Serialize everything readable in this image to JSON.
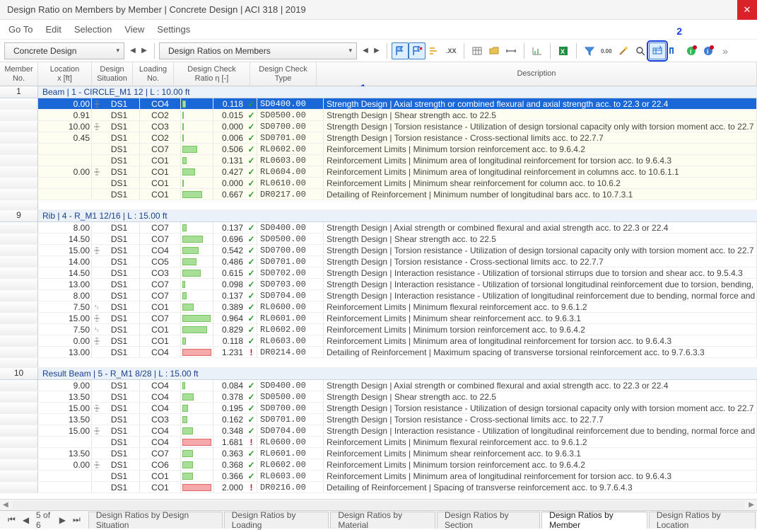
{
  "title": "Design Ratio on Members by Member | Concrete Design | ACI 318 | 2019",
  "menu": [
    "Go To",
    "Edit",
    "Selection",
    "View",
    "Settings"
  ],
  "dropdown1": "Concrete Design",
  "dropdown2": "Design Ratios on Members",
  "callouts": {
    "one": "1",
    "two": "2"
  },
  "headers": {
    "member": "Member\nNo.",
    "location": "Location\nx [ft]",
    "situation": "Design\nSituation",
    "loading": "Loading\nNo.",
    "ratio": "Design Check\nRatio η [-]",
    "type": "Design Check\nType",
    "desc": "Description"
  },
  "tabs": {
    "page": "5 of 6",
    "items": [
      "Design Ratios by Design Situation",
      "Design Ratios by Loading",
      "Design Ratios by Material",
      "Design Ratios by Section",
      "Design Ratios by Member",
      "Design Ratios by Location"
    ],
    "active": 4
  },
  "groups": [
    {
      "member": "1",
      "title": "Beam | 1 - CIRCLE_M1 12 | L : 10.00 ft",
      "yellow": true,
      "rows": [
        {
          "loc": "0.00",
          "lico": true,
          "ds": "DS1",
          "ln": "CO4",
          "bar": 0.118,
          "ratio": "0.118",
          "ok": true,
          "type": "SD0400.00",
          "desc": "Strength Design | Axial strength or combined flexural and axial strength acc. to 22.3 or 22.4",
          "sel": true
        },
        {
          "loc": "0.91",
          "lico": false,
          "ds": "DS1",
          "ln": "CO2",
          "bar": 0.015,
          "ratio": "0.015",
          "ok": true,
          "type": "SD0500.00",
          "desc": "Strength Design | Shear strength acc. to 22.5"
        },
        {
          "loc": "10.00",
          "lico": true,
          "ds": "DS1",
          "ln": "CO3",
          "bar": 0.0,
          "ratio": "0.000",
          "ok": true,
          "type": "SD0700.00",
          "desc": "Strength Design | Torsion resistance - Utilization of design torsional capacity only with torsion moment acc. to 22.7"
        },
        {
          "loc": "0.45",
          "lico": false,
          "ds": "DS1",
          "ln": "CO2",
          "bar": 0.006,
          "ratio": "0.006",
          "ok": true,
          "type": "SD0701.00",
          "desc": "Strength Design | Torsion resistance - Cross-sectional limits acc. to 22.7.7"
        },
        {
          "loc": "",
          "lico": false,
          "ds": "DS1",
          "ln": "CO7",
          "bar": 0.506,
          "ratio": "0.506",
          "ok": true,
          "type": "RL0602.00",
          "desc": "Reinforcement Limits | Minimum torsion reinforcement acc. to 9.6.4.2"
        },
        {
          "loc": "",
          "lico": false,
          "ds": "DS1",
          "ln": "CO1",
          "bar": 0.131,
          "ratio": "0.131",
          "ok": true,
          "type": "RL0603.00",
          "desc": "Reinforcement Limits | Minimum area of longitudinal reinforcement for torsion acc. to 9.6.4.3"
        },
        {
          "loc": "0.00",
          "lico": true,
          "ds": "DS1",
          "ln": "CO1",
          "bar": 0.427,
          "ratio": "0.427",
          "ok": true,
          "type": "RL0604.00",
          "desc": "Reinforcement Limits | Minimum area of longitudinal reinforcement in columns acc. to 10.6.1.1"
        },
        {
          "loc": "",
          "lico": false,
          "ds": "DS1",
          "ln": "CO1",
          "bar": 0.0,
          "ratio": "0.000",
          "ok": true,
          "type": "RL0610.00",
          "desc": "Reinforcement Limits | Minimum shear reinforcement for column acc. to 10.6.2"
        },
        {
          "loc": "",
          "lico": false,
          "ds": "DS1",
          "ln": "CO1",
          "bar": 0.667,
          "ratio": "0.667",
          "ok": true,
          "type": "DR0217.00",
          "desc": "Detailing of Reinforcement | Minimum number of longitudinal bars acc. to 10.7.3.1"
        }
      ]
    },
    {
      "member": "9",
      "title": "Rib | 4 - R_M1 12/16 | L : 15.00 ft",
      "yellow": false,
      "rows": [
        {
          "loc": "8.00",
          "lico": false,
          "ds": "DS1",
          "ln": "CO7",
          "bar": 0.137,
          "ratio": "0.137",
          "ok": true,
          "type": "SD0400.00",
          "desc": "Strength Design | Axial strength or combined flexural and axial strength acc. to 22.3 or 22.4"
        },
        {
          "loc": "14.50",
          "lico": false,
          "ds": "DS1",
          "ln": "CO7",
          "bar": 0.696,
          "ratio": "0.696",
          "ok": true,
          "type": "SD0500.00",
          "desc": "Strength Design | Shear strength acc. to 22.5"
        },
        {
          "loc": "15.00",
          "lico": true,
          "ds": "DS1",
          "ln": "CO4",
          "bar": 0.542,
          "ratio": "0.542",
          "ok": true,
          "type": "SD0700.00",
          "desc": "Strength Design | Torsion resistance - Utilization of design torsional capacity only with torsion moment acc. to 22.7"
        },
        {
          "loc": "14.00",
          "lico": false,
          "ds": "DS1",
          "ln": "CO5",
          "bar": 0.486,
          "ratio": "0.486",
          "ok": true,
          "type": "SD0701.00",
          "desc": "Strength Design | Torsion resistance - Cross-sectional limits acc. to 22.7.7"
        },
        {
          "loc": "14.50",
          "lico": false,
          "ds": "DS1",
          "ln": "CO3",
          "bar": 0.615,
          "ratio": "0.615",
          "ok": true,
          "type": "SD0702.00",
          "desc": "Strength Design | Interaction resistance - Utilization of torsional stirrups due to torsion and shear acc. to 9.5.4.3"
        },
        {
          "loc": "13.00",
          "lico": false,
          "ds": "DS1",
          "ln": "CO7",
          "bar": 0.098,
          "ratio": "0.098",
          "ok": true,
          "type": "SD0703.00",
          "desc": "Strength Design | Interaction resistance - Utilization of torsional longitudinal reinforcement due to torsion, bending, no"
        },
        {
          "loc": "8.00",
          "lico": false,
          "ds": "DS1",
          "ln": "CO7",
          "bar": 0.137,
          "ratio": "0.137",
          "ok": true,
          "type": "SD0704.00",
          "desc": "Strength Design | Interaction resistance - Utilization of longitudinal reinforcement due to bending, normal force and sh"
        },
        {
          "loc": "7.50",
          "lico7": true,
          "ds": "DS1",
          "ln": "CO1",
          "bar": 0.389,
          "ratio": "0.389",
          "ok": true,
          "type": "RL0600.00",
          "desc": "Reinforcement Limits | Minimum flexural reinforcement acc. to 9.6.1.2"
        },
        {
          "loc": "15.00",
          "lico": true,
          "ds": "DS1",
          "ln": "CO7",
          "bar": 0.964,
          "ratio": "0.964",
          "ok": true,
          "type": "RL0601.00",
          "desc": "Reinforcement Limits | Minimum shear reinforcement acc. to 9.6.3.1"
        },
        {
          "loc": "7.50",
          "lico7": true,
          "ds": "DS1",
          "ln": "CO1",
          "bar": 0.829,
          "ratio": "0.829",
          "ok": true,
          "type": "RL0602.00",
          "desc": "Reinforcement Limits | Minimum torsion reinforcement acc. to 9.6.4.2"
        },
        {
          "loc": "0.00",
          "lico": true,
          "ds": "DS1",
          "ln": "CO1",
          "bar": 0.118,
          "ratio": "0.118",
          "ok": true,
          "type": "RL0603.00",
          "desc": "Reinforcement Limits | Minimum area of longitudinal reinforcement for torsion acc. to 9.6.4.3"
        },
        {
          "loc": "13.00",
          "lico": false,
          "ds": "DS1",
          "ln": "CO4",
          "bar": 1.231,
          "ratio": "1.231",
          "ok": false,
          "type": "DR0214.00",
          "desc": "Detailing of Reinforcement | Maximum spacing of transverse torsional reinforcement acc. to 9.7.6.3.3"
        }
      ]
    },
    {
      "member": "10",
      "title": "Result Beam | 5 - R_M1 8/28 | L : 15.00 ft",
      "yellow": false,
      "rows": [
        {
          "loc": "9.00",
          "lico": false,
          "ds": "DS1",
          "ln": "CO4",
          "bar": 0.084,
          "ratio": "0.084",
          "ok": true,
          "type": "SD0400.00",
          "desc": "Strength Design | Axial strength or combined flexural and axial strength acc. to 22.3 or 22.4"
        },
        {
          "loc": "13.50",
          "lico": false,
          "ds": "DS1",
          "ln": "CO4",
          "bar": 0.378,
          "ratio": "0.378",
          "ok": true,
          "type": "SD0500.00",
          "desc": "Strength Design | Shear strength acc. to 22.5"
        },
        {
          "loc": "15.00",
          "lico": true,
          "ds": "DS1",
          "ln": "CO4",
          "bar": 0.195,
          "ratio": "0.195",
          "ok": true,
          "type": "SD0700.00",
          "desc": "Strength Design | Torsion resistance - Utilization of design torsional capacity only with torsion moment acc. to 22.7"
        },
        {
          "loc": "13.50",
          "lico": false,
          "ds": "DS1",
          "ln": "CO3",
          "bar": 0.162,
          "ratio": "0.162",
          "ok": true,
          "type": "SD0701.00",
          "desc": "Strength Design | Torsion resistance - Cross-sectional limits acc. to 22.7.7"
        },
        {
          "loc": "15.00",
          "lico": true,
          "ds": "DS1",
          "ln": "CO4",
          "bar": 0.348,
          "ratio": "0.348",
          "ok": true,
          "type": "SD0704.00",
          "desc": "Strength Design | Interaction resistance - Utilization of longitudinal reinforcement due to bending, normal force and sh"
        },
        {
          "loc": "",
          "lico": false,
          "ds": "DS1",
          "ln": "CO4",
          "bar": 1.681,
          "ratio": "1.681",
          "ok": false,
          "type": "RL0600.00",
          "desc": "Reinforcement Limits | Minimum flexural reinforcement acc. to 9.6.1.2"
        },
        {
          "loc": "13.50",
          "lico": false,
          "ds": "DS1",
          "ln": "CO7",
          "bar": 0.363,
          "ratio": "0.363",
          "ok": true,
          "type": "RL0601.00",
          "desc": "Reinforcement Limits | Minimum shear reinforcement acc. to 9.6.3.1"
        },
        {
          "loc": "0.00",
          "lico": true,
          "ds": "DS1",
          "ln": "CO6",
          "bar": 0.368,
          "ratio": "0.368",
          "ok": true,
          "type": "RL0602.00",
          "desc": "Reinforcement Limits | Minimum torsion reinforcement acc. to 9.6.4.2"
        },
        {
          "loc": "",
          "lico": false,
          "ds": "DS1",
          "ln": "CO1",
          "bar": 0.366,
          "ratio": "0.366",
          "ok": true,
          "type": "RL0603.00",
          "desc": "Reinforcement Limits | Minimum area of longitudinal reinforcement for torsion acc. to 9.6.4.3"
        },
        {
          "loc": "",
          "lico": false,
          "ds": "DS1",
          "ln": "CO1",
          "bar": 2.0,
          "ratio": "2.000",
          "ok": false,
          "type": "DR0216.00",
          "desc": "Detailing of Reinforcement | Spacing of transverse reinforcement acc. to 9.7.6.4.3"
        }
      ]
    }
  ]
}
